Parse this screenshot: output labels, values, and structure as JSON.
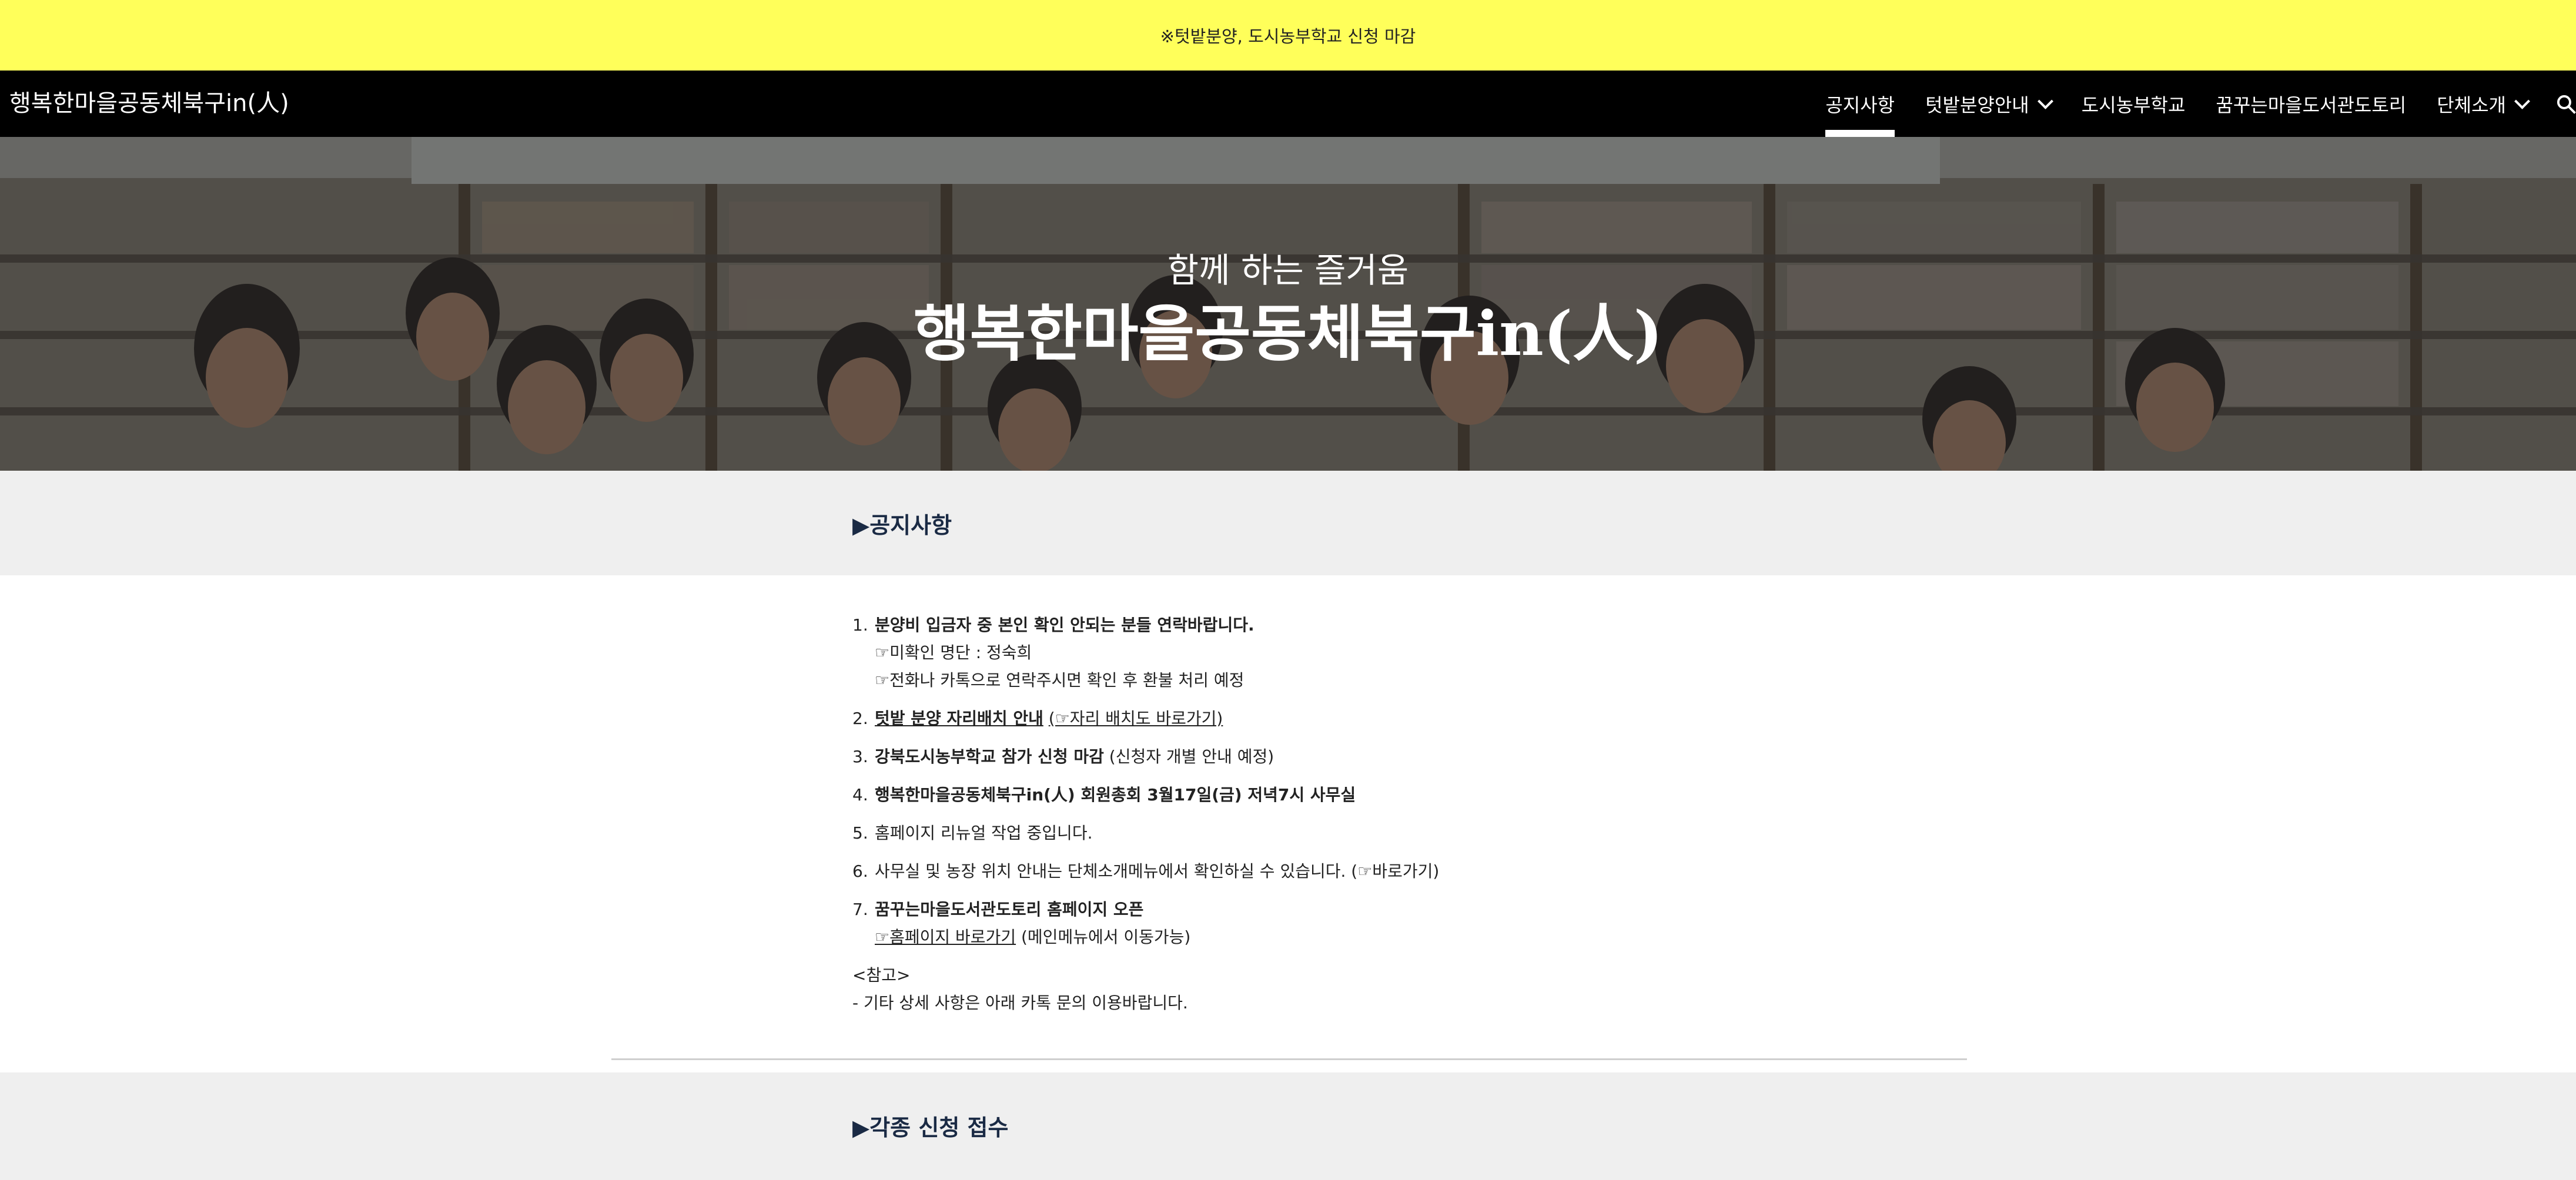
{
  "announcement": {
    "text": "※텃밭분양, 도시농부학교 신청 마감"
  },
  "nav": {
    "site_title": "행복한마을공동체북구in(人)",
    "items": [
      {
        "label": "공지사항",
        "active": true,
        "dropdown": false
      },
      {
        "label": "텃밭분양안내",
        "active": false,
        "dropdown": true
      },
      {
        "label": "도시농부학교",
        "active": false,
        "dropdown": false
      },
      {
        "label": "꿈꾸는마을도서관도토리",
        "active": false,
        "dropdown": false
      },
      {
        "label": "단체소개",
        "active": false,
        "dropdown": true
      }
    ],
    "search_icon": "search-icon"
  },
  "hero": {
    "subtitle": "함께 하는 즐거움",
    "title": "행복한마을공동체북구in(人)"
  },
  "notice_section": {
    "heading": "▶공지사항"
  },
  "notices": [
    {
      "num": "1.",
      "bold": "분양비 입금자 중 본인 확인 안되는 분들 연락바랍니다.",
      "rest": "",
      "sub1": "☞미확인 명단 : 정숙희",
      "sub2": "☞전화나 카톡으로 연락주시면 확인 후 환불 처리 예정"
    },
    {
      "num": "2.",
      "bold": "텃밭 분양 자리배치 안내",
      "link": "(☞자리 배치도 바로가기)"
    },
    {
      "num": "3.",
      "bold": "강북도시농부학교 참가 신청 마감",
      "rest": " (신청자 개별 안내 예정)"
    },
    {
      "num": "4.",
      "bold": "행복한마을공동체북구in(人) 회원총회 3월17일(금) 저녁7시 사무실"
    },
    {
      "num": "5.",
      "text": "홈페이지 리뉴얼 작업 중입니다."
    },
    {
      "num": "6.",
      "text": "사무실 및 농장 위치 안내는 단체소개메뉴에서 확인하실 수 있습니다. (☞바로가기)"
    },
    {
      "num": "7.",
      "bold": "꿈꾸는마을도서관도토리 홈페이지 오픈",
      "link": "☞홈페이지 바로가기",
      "rest": " (메인메뉴에서 이동가능)"
    }
  ],
  "note": {
    "title": "<참고>",
    "text": "- 기타 상세 사항은 아래 카톡 문의 이용바랍니다."
  },
  "apply_section": {
    "heading": "▶각종 신청 접수"
  },
  "colors": {
    "announce_bg": "#ffff5a",
    "nav_bg": "#000000",
    "section_bg": "#efefef",
    "heading": "#1a2a44"
  }
}
